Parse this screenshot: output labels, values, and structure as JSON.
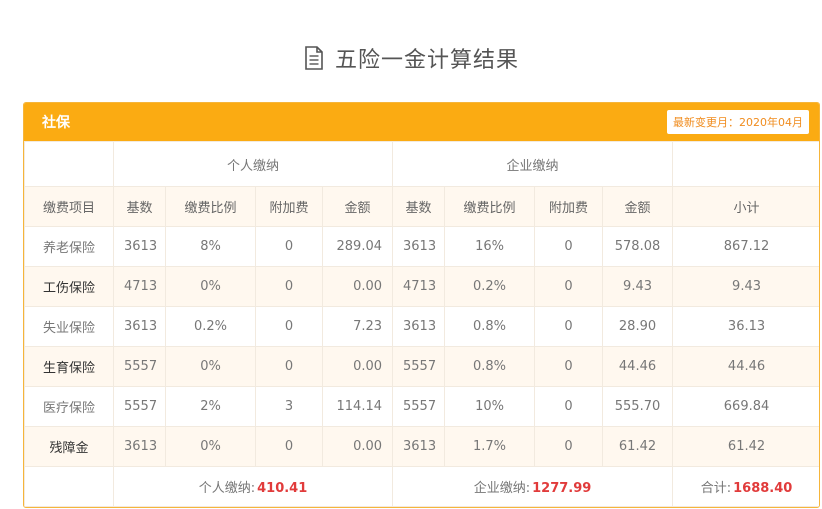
{
  "page": {
    "title": "五险一金计算结果"
  },
  "panel": {
    "title": "社保",
    "update_badge": "最新变更月：2020年04月"
  },
  "table": {
    "group_headers": {
      "personal": "个人缴纳",
      "company": "企业缴纳"
    },
    "columns": [
      "缴费项目",
      "基数",
      "缴费比例",
      "附加费",
      "金额",
      "基数",
      "缴费比例",
      "附加费",
      "金额",
      "小计"
    ],
    "rows": [
      [
        "养老保险",
        "3613",
        "8%",
        "0",
        "289.04",
        "3613",
        "16%",
        "0",
        "578.08",
        "867.12"
      ],
      [
        "工伤保险",
        "4713",
        "0%",
        "0",
        "0.00",
        "4713",
        "0.2%",
        "0",
        "9.43",
        "9.43"
      ],
      [
        "失业保险",
        "3613",
        "0.2%",
        "0",
        "7.23",
        "3613",
        "0.8%",
        "0",
        "28.90",
        "36.13"
      ],
      [
        "生育保险",
        "5557",
        "0%",
        "0",
        "0.00",
        "5557",
        "0.8%",
        "0",
        "44.46",
        "44.46"
      ],
      [
        "医疗保险",
        "5557",
        "2%",
        "3",
        "114.14",
        "5557",
        "10%",
        "0",
        "555.70",
        "669.84"
      ],
      [
        "残障金",
        "3613",
        "0%",
        "0",
        "0.00",
        "3613",
        "1.7%",
        "0",
        "61.42",
        "61.42"
      ]
    ],
    "totals": {
      "personal_label": "个人缴纳:",
      "personal_value": "410.41",
      "company_label": "企业缴纳:",
      "company_value": "1277.99",
      "grand_label": "合计:",
      "grand_value": "1688.40"
    }
  },
  "colors": {
    "accent": "#fbab12",
    "total_value": "#e13b3b",
    "alt_row": "#fff8ef"
  },
  "icons": {
    "title_icon": "document-icon"
  }
}
